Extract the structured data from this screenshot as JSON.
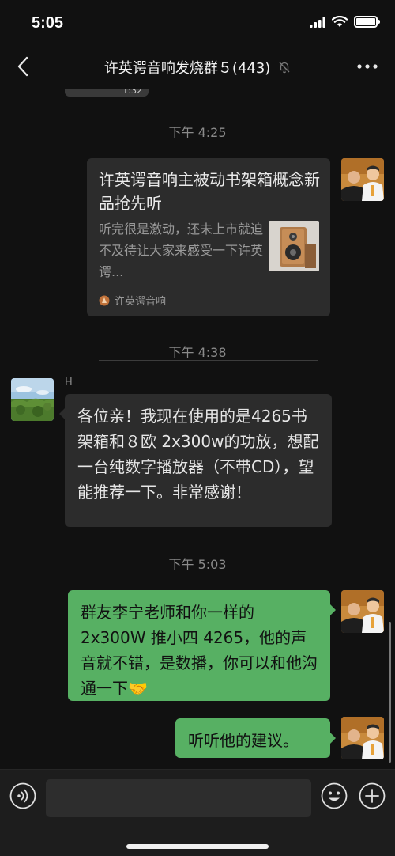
{
  "status_bar": {
    "time": "5:05"
  },
  "header": {
    "title": "许英谔音响发烧群５(443)",
    "icons": [
      "back-icon",
      "muted-bell-icon",
      "more-icon"
    ]
  },
  "chat": {
    "previous_video_duration": "1:32",
    "messages": [
      {
        "type": "timestamp",
        "text": "下午 4:25"
      },
      {
        "type": "link_card",
        "side": "right",
        "title": "许英谔音响主被动书架箱概念新品抢先听",
        "description": "听完很是激动，还未上市就迫不及待让大家来感受一下许英谔...",
        "source": "许英谔音响"
      },
      {
        "type": "timestamp",
        "text": "下午 4:38"
      },
      {
        "type": "text",
        "side": "left",
        "sender": "H",
        "text": "各位亲！我现在使用的是4265书架箱和８欧 2x300w的功放，想配一台纯数字播放器（不带CD），望能推荐一下。非常感谢！"
      },
      {
        "type": "timestamp",
        "text": "下午 5:03"
      },
      {
        "type": "text",
        "side": "right",
        "text": "群友李宁老师和你一样的2x300W 推小四 4265，他的声音就不错，是数播，你可以和他沟通一下🤝"
      },
      {
        "type": "text",
        "side": "right",
        "text": "听听他的建议。"
      }
    ]
  },
  "input_bar": {
    "value": "",
    "icons": [
      "voice-icon",
      "emoji-icon",
      "plus-icon"
    ]
  },
  "colors": {
    "background": "#111111",
    "bubble_outgoing": "#57b063",
    "bubble_incoming": "#2c2c2c",
    "timestamp_text": "#8a8a8a"
  }
}
